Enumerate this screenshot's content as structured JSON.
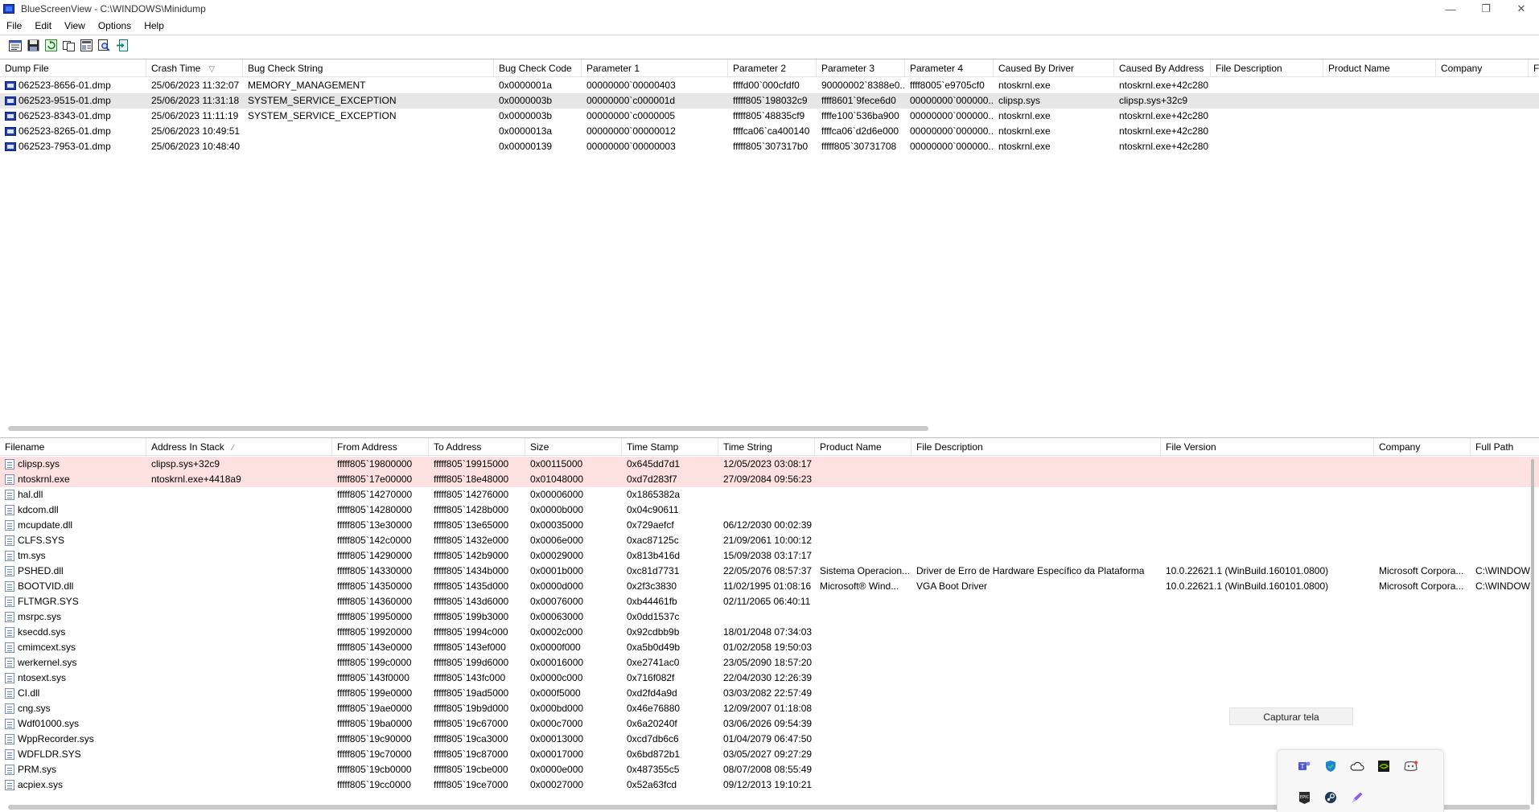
{
  "window": {
    "title": "BlueScreenView  -  C:\\WINDOWS\\Minidump",
    "controls": {
      "minimize": "—",
      "restore": "❐",
      "close": "✕"
    }
  },
  "menu": [
    "File",
    "Edit",
    "View",
    "Options",
    "Help"
  ],
  "toolbar_icons": [
    "properties-icon",
    "save-icon",
    "refresh-icon",
    "copy-icon",
    "html-report-icon",
    "find-icon",
    "exit-icon"
  ],
  "dump_table": {
    "columns": [
      "Dump File",
      "Crash Time",
      "Bug Check String",
      "Bug Check Code",
      "Parameter 1",
      "Parameter 2",
      "Parameter 3",
      "Parameter 4",
      "Caused By Driver",
      "Caused By Address",
      "File Description",
      "Product Name",
      "Company",
      "Fil"
    ],
    "rows": [
      [
        "062523-8656-01.dmp",
        "25/06/2023 11:32:07",
        "MEMORY_MANAGEMENT",
        "0x0000001a",
        "00000000`00000403",
        "ffffd00`000cfdf0",
        "90000002`8388e0...",
        "ffff8005`e9705cf0",
        "ntoskrnl.exe",
        "ntoskrnl.exe+42c280",
        "",
        "",
        "",
        ""
      ],
      [
        "062523-9515-01.dmp",
        "25/06/2023 11:31:18",
        "SYSTEM_SERVICE_EXCEPTION",
        "0x0000003b",
        "00000000`c000001d",
        "fffff805`198032c9",
        "ffff8601`9fece6d0",
        "00000000`000000...",
        "clipsp.sys",
        "clipsp.sys+32c9",
        "",
        "",
        "",
        ""
      ],
      [
        "062523-8343-01.dmp",
        "25/06/2023 11:11:19",
        "SYSTEM_SERVICE_EXCEPTION",
        "0x0000003b",
        "00000000`c0000005",
        "fffff805`48835cf9",
        "ffffe100`536ba900",
        "00000000`000000...",
        "ntoskrnl.exe",
        "ntoskrnl.exe+42c280",
        "",
        "",
        "",
        ""
      ],
      [
        "062523-8265-01.dmp",
        "25/06/2023 10:49:51",
        "",
        "0x0000013a",
        "00000000`00000012",
        "ffffca06`ca400140",
        "ffffca06`d2d6e000",
        "00000000`000000...",
        "ntoskrnl.exe",
        "ntoskrnl.exe+42c280",
        "",
        "",
        "",
        ""
      ],
      [
        "062523-7953-01.dmp",
        "25/06/2023 10:48:40",
        "",
        "0x00000139",
        "00000000`00000003",
        "fffff805`307317b0",
        "fffff805`30731708",
        "00000000`000000...",
        "ntoskrnl.exe",
        "ntoskrnl.exe+42c280",
        "",
        "",
        "",
        ""
      ]
    ]
  },
  "driver_table": {
    "columns": [
      "Filename",
      "Address In Stack",
      "From Address",
      "To Address",
      "Size",
      "Time Stamp",
      "Time String",
      "Product Name",
      "File Description",
      "File Version",
      "Company",
      "Full Path"
    ],
    "rows": [
      [
        "clipsp.sys",
        "clipsp.sys+32c9",
        "fffff805`19800000",
        "fffff805`19915000",
        "0x00115000",
        "0x645dd7d1",
        "12/05/2023 03:08:17",
        "",
        "",
        "",
        "",
        ""
      ],
      [
        "ntoskrnl.exe",
        "ntoskrnl.exe+4418a9",
        "fffff805`17e00000",
        "fffff805`18e48000",
        "0x01048000",
        "0xd7d283f7",
        "27/09/2084 09:56:23",
        "",
        "",
        "",
        "",
        ""
      ],
      [
        "hal.dll",
        "",
        "fffff805`14270000",
        "fffff805`14276000",
        "0x00006000",
        "0x1865382a",
        "",
        "",
        "",
        "",
        "",
        ""
      ],
      [
        "kdcom.dll",
        "",
        "fffff805`14280000",
        "fffff805`1428b000",
        "0x0000b000",
        "0x04c90611",
        "",
        "",
        "",
        "",
        "",
        ""
      ],
      [
        "mcupdate.dll",
        "",
        "fffff805`13e30000",
        "fffff805`13e65000",
        "0x00035000",
        "0x729aefcf",
        "06/12/2030 00:02:39",
        "",
        "",
        "",
        "",
        ""
      ],
      [
        "CLFS.SYS",
        "",
        "fffff805`142c0000",
        "fffff805`1432e000",
        "0x0006e000",
        "0xac87125c",
        "21/09/2061 10:00:12",
        "",
        "",
        "",
        "",
        ""
      ],
      [
        "tm.sys",
        "",
        "fffff805`14290000",
        "fffff805`142b9000",
        "0x00029000",
        "0x813b416d",
        "15/09/2038 03:17:17",
        "",
        "",
        "",
        "",
        ""
      ],
      [
        "PSHED.dll",
        "",
        "fffff805`14330000",
        "fffff805`1434b000",
        "0x0001b000",
        "0xc81d7731",
        "22/05/2076 08:57:37",
        "Sistema Operacion...",
        "Driver de Erro de Hardware Específico da Plataforma",
        "10.0.22621.1 (WinBuild.160101.0800)",
        "Microsoft Corpora...",
        "C:\\WINDOW"
      ],
      [
        "BOOTVID.dll",
        "",
        "fffff805`14350000",
        "fffff805`1435d000",
        "0x0000d000",
        "0x2f3c3830",
        "11/02/1995 01:08:16",
        "Microsoft® Wind...",
        "VGA Boot Driver",
        "10.0.22621.1 (WinBuild.160101.0800)",
        "Microsoft Corpora...",
        "C:\\WINDOW"
      ],
      [
        "FLTMGR.SYS",
        "",
        "fffff805`14360000",
        "fffff805`143d6000",
        "0x00076000",
        "0xb44461fb",
        "02/11/2065 06:40:11",
        "",
        "",
        "",
        "",
        ""
      ],
      [
        "msrpc.sys",
        "",
        "fffff805`19950000",
        "fffff805`199b3000",
        "0x00063000",
        "0x0dd1537c",
        "",
        "",
        "",
        "",
        "",
        ""
      ],
      [
        "ksecdd.sys",
        "",
        "fffff805`19920000",
        "fffff805`1994c000",
        "0x0002c000",
        "0x92cdbb9b",
        "18/01/2048 07:34:03",
        "",
        "",
        "",
        "",
        ""
      ],
      [
        "cmimcext.sys",
        "",
        "fffff805`143e0000",
        "fffff805`143ef000",
        "0x0000f000",
        "0xa5b0d49b",
        "01/02/2058 19:50:03",
        "",
        "",
        "",
        "",
        ""
      ],
      [
        "werkernel.sys",
        "",
        "fffff805`199c0000",
        "fffff805`199d6000",
        "0x00016000",
        "0xe2741ac0",
        "23/05/2090 18:57:20",
        "",
        "",
        "",
        "",
        ""
      ],
      [
        "ntosext.sys",
        "",
        "fffff805`143f0000",
        "fffff805`143fc000",
        "0x0000c000",
        "0x716f082f",
        "22/04/2030 12:26:39",
        "",
        "",
        "",
        "",
        ""
      ],
      [
        "CI.dll",
        "",
        "fffff805`199e0000",
        "fffff805`19ad5000",
        "0x000f5000",
        "0xd2fd4a9d",
        "03/03/2082 22:57:49",
        "",
        "",
        "",
        "",
        ""
      ],
      [
        "cng.sys",
        "",
        "fffff805`19ae0000",
        "fffff805`19b9d000",
        "0x000bd000",
        "0x46e76880",
        "12/09/2007 01:18:08",
        "",
        "",
        "",
        "",
        ""
      ],
      [
        "Wdf01000.sys",
        "",
        "fffff805`19ba0000",
        "fffff805`19c67000",
        "0x000c7000",
        "0x6a20240f",
        "03/06/2026 09:54:39",
        "",
        "",
        "",
        "",
        ""
      ],
      [
        "WppRecorder.sys",
        "",
        "fffff805`19c90000",
        "fffff805`19ca3000",
        "0x00013000",
        "0xcd7db6c6",
        "01/04/2079 06:47:50",
        "",
        "",
        "",
        "",
        ""
      ],
      [
        "WDFLDR.SYS",
        "",
        "fffff805`19c70000",
        "fffff805`19c87000",
        "0x00017000",
        "0x6bd872b1",
        "03/05/2027 09:27:29",
        "",
        "",
        "",
        "",
        ""
      ],
      [
        "PRM.sys",
        "",
        "fffff805`19cb0000",
        "fffff805`19cbe000",
        "0x0000e000",
        "0x487355c5",
        "08/07/2008 08:55:49",
        "",
        "",
        "",
        "",
        ""
      ],
      [
        "acpiex.sys",
        "",
        "fffff805`19cc0000",
        "fffff805`19ce7000",
        "0x00027000",
        "0x52a63fcd",
        "09/12/2013 19:10:21",
        "",
        "",
        "",
        "",
        ""
      ]
    ]
  },
  "capture_tooltip": "Capturar tela",
  "tray_icons": [
    "teams-icon",
    "defender-icon",
    "onedrive-icon",
    "nvidia-icon",
    "discord-icon",
    "epic-games-icon",
    "steam-icon",
    "pen-icon"
  ]
}
